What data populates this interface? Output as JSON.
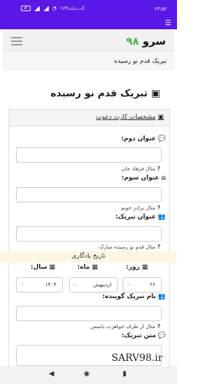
{
  "statusbar": {
    "time": "۲۳:۵۲",
    "network": "۱۶۳ک.ب/ث",
    "battery": "۵۲"
  },
  "navbar": {
    "brand_text": "سرو",
    "brand_num": "۹۸"
  },
  "breadcrumb": "تبریک قدم نو رسیده",
  "page_title": "تبریک قدم نو رسیده",
  "card": {
    "header": "مشخصات کارت دعوت",
    "fields": [
      {
        "label": "عنوان دوم:",
        "hint": "مثال فرهاد جان"
      },
      {
        "label": "عنوان سوم:",
        "hint": "مثال برادر خوبم"
      },
      {
        "label": "عنوان تبریک:",
        "hint": "مثال قدم نو رسیده مبارک"
      }
    ],
    "memory_date": "تاریخ یادگاری",
    "date": {
      "day_label": "روز:",
      "day_value": "۲۶",
      "month_label": "ماه:",
      "month_value": "اردیبهش",
      "year_label": "سال:",
      "year_value": "۱۴۰۴"
    },
    "sender": {
      "label": "نام تبریک گوینده:",
      "hint": "مثال از طرف خواهرت یاسمن"
    },
    "message_label": "متن تبریک:"
  },
  "watermark": "SARV98.ir"
}
